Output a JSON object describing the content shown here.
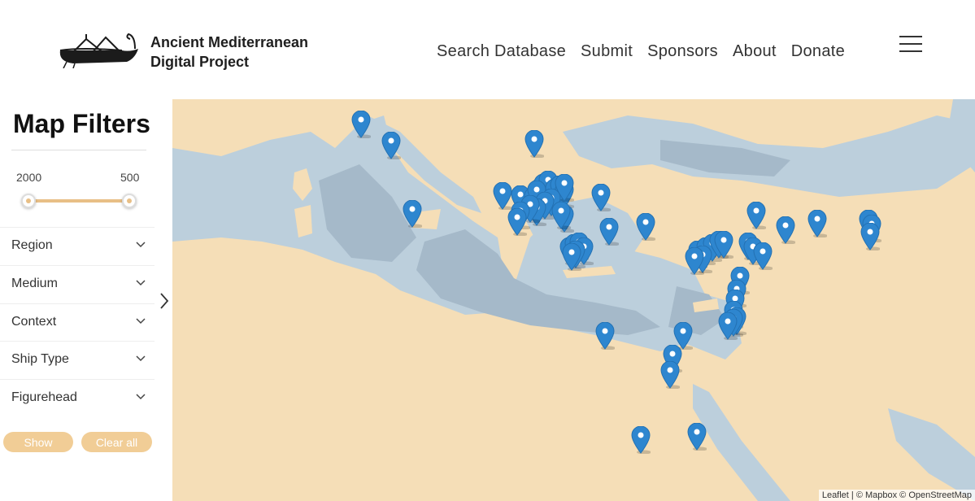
{
  "header": {
    "logo_line1": "Ancient Mediterranean",
    "logo_line2": "Digital Project",
    "nav": [
      {
        "label": "Search Database"
      },
      {
        "label": "Submit"
      },
      {
        "label": "Sponsors"
      },
      {
        "label": "About"
      },
      {
        "label": "Donate"
      }
    ],
    "menu_icon": "hamburger-icon"
  },
  "sidebar": {
    "title": "Map Filters",
    "range": {
      "min_label": "2000",
      "max_label": "500"
    },
    "filters": [
      {
        "label": "Region"
      },
      {
        "label": "Medium"
      },
      {
        "label": "Context"
      },
      {
        "label": "Ship Type"
      },
      {
        "label": "Figurehead"
      }
    ],
    "show_label": "Show",
    "clear_label": "Clear all",
    "collapse_icon": "chevron-right-icon"
  },
  "map": {
    "attribution": "Leaflet | © Mapbox © OpenStreetMap",
    "land_color": "#f5deb7",
    "sea_color": "#bccfdc",
    "deep_sea_color": "#a5b9c9",
    "marker_color": "#2e86cf",
    "marker_count": 60
  }
}
